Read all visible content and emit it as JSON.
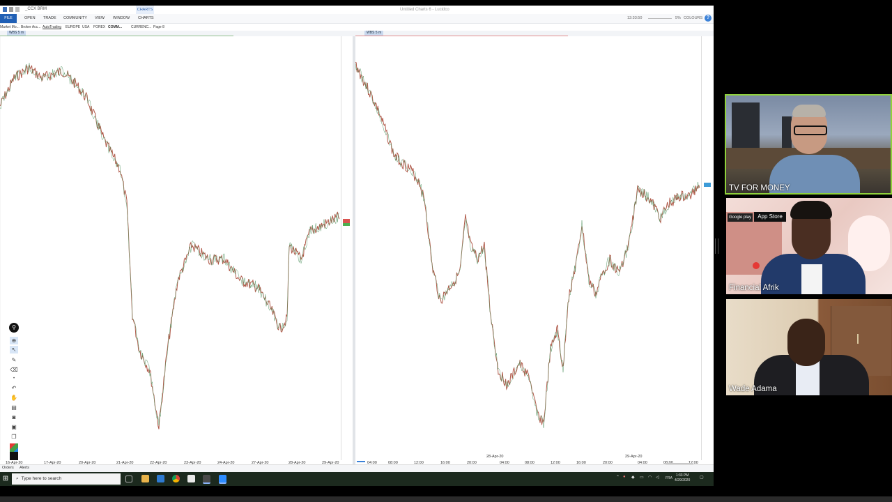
{
  "app": {
    "tab_name": "_CCX BRM",
    "window_title": "Untitled Charts 6 - Lucidco",
    "charts_tab": "CHARTS",
    "menu": [
      "FILE",
      "OPEN",
      "TRADE",
      "COMMUNITY",
      "VIEW",
      "WINDOW",
      "CHARTS"
    ],
    "right_controls": [
      "13:33:50",
      "5%",
      "COLOURS"
    ],
    "subtabs": [
      "Market Mo...",
      "Broker Acc...",
      "AutoTrading",
      "EUROPE",
      "USA",
      "FOREX",
      "COMM...",
      "CURRENC...",
      "Page 8"
    ],
    "instrument_tab_left": "WBS 5 m",
    "instrument_tab_right": "WBS 5 m"
  },
  "chart_left": {
    "x_ticks": [
      "16-Apr-20",
      "17-Apr-20",
      "20-Apr-20",
      "21-Apr-20",
      "22-Apr-20",
      "23-Apr-20",
      "24-Apr-20",
      "27-Apr-20",
      "28-Apr-20",
      "29-Apr-20"
    ]
  },
  "chart_right": {
    "x_ticks": [
      "04:00",
      "08:00",
      "12:00",
      "16:00",
      "20:00",
      "28-Apr-20",
      "04:00",
      "08:00",
      "12:00",
      "16:00",
      "20:00",
      "29-Apr-20",
      "04:00",
      "08:00",
      "12:00"
    ]
  },
  "status": {
    "orders": "Orders",
    "alerts": "Alerts"
  },
  "taskbar": {
    "search_placeholder": "Type here to search",
    "lang": "FRA",
    "time": "1:33 PM",
    "date": "4/29/2020"
  },
  "participants": [
    {
      "name": "TV FOR MONEY",
      "speaking": true,
      "accent": "#8fd13b"
    },
    {
      "name": "Financial Afrik",
      "speaking": false
    },
    {
      "name": "Wade Adama",
      "speaking": false
    }
  ],
  "video_overlay_text": {
    "app_store_badge": "App Store",
    "google_play_badge": "Google play"
  }
}
